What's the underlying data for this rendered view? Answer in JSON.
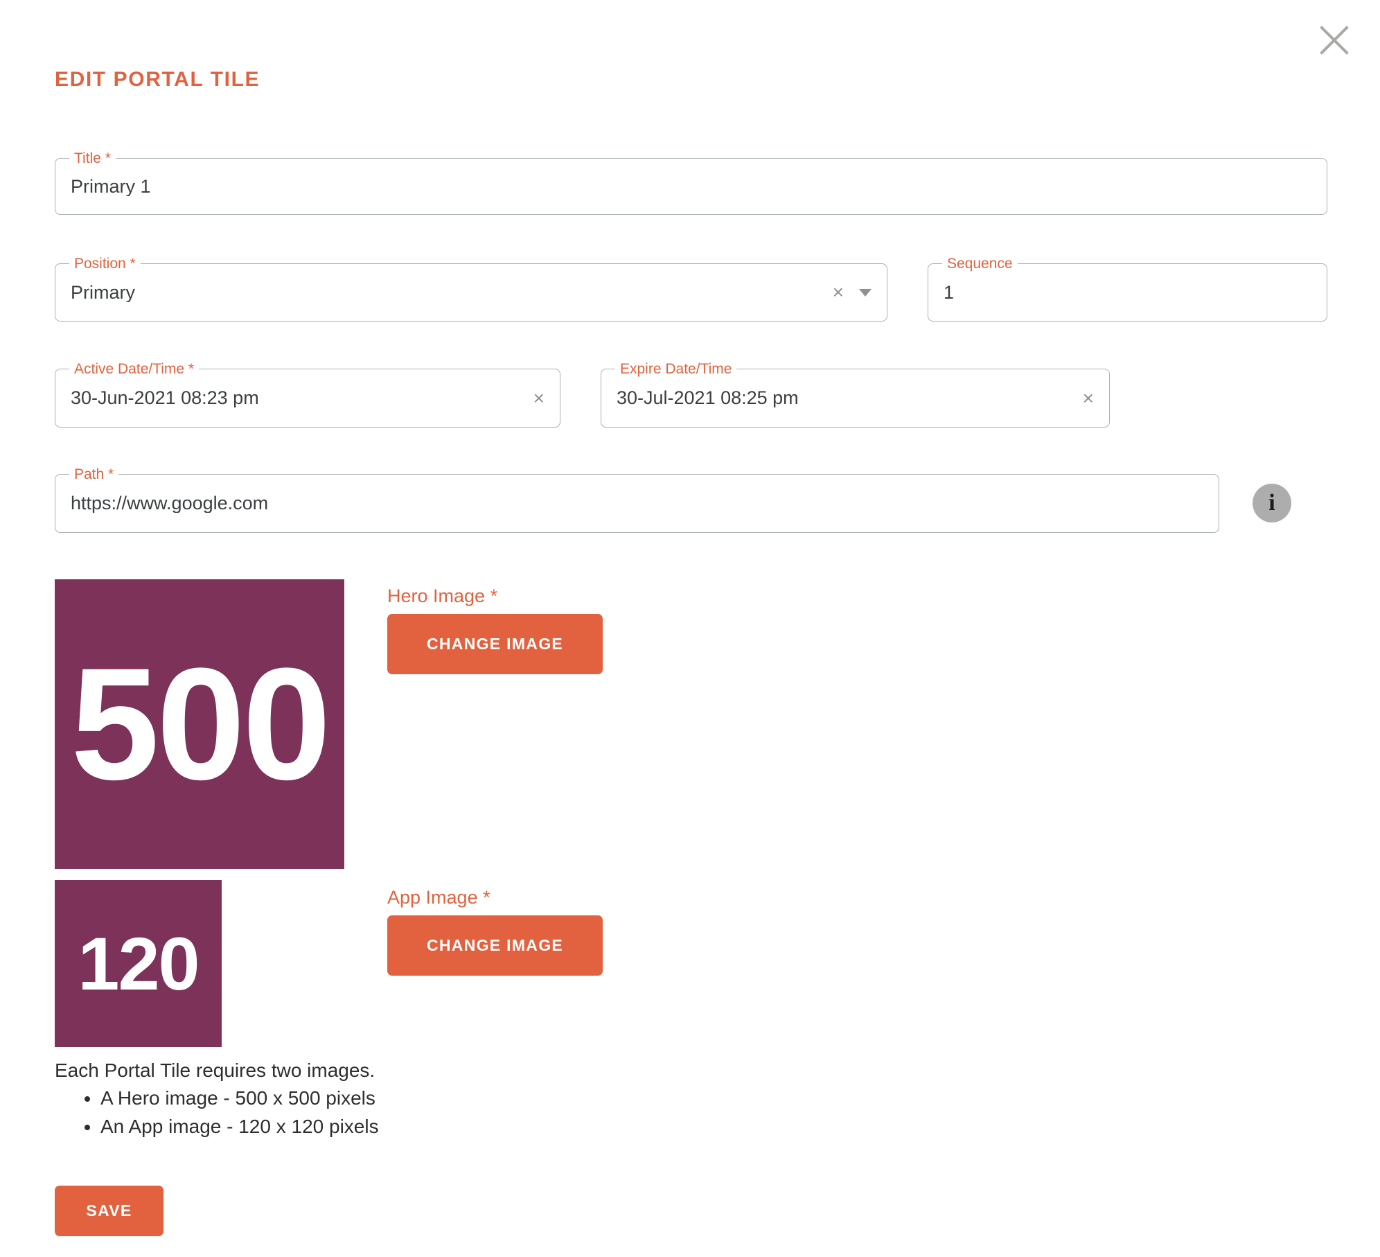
{
  "dialog": {
    "title": "EDIT PORTAL TILE",
    "close_label": "close-icon"
  },
  "accent_colors": {
    "brand_orange": "#E2623F",
    "tile_maroon": "#7D3259",
    "field_border": "#ABB0B0",
    "info_badge_grey": "#ADADAD"
  },
  "fields": {
    "title": {
      "label": "Title *",
      "value": "Primary 1"
    },
    "position": {
      "label": "Position *",
      "value": "Primary",
      "clear_glyph": "×",
      "caret": "chevron-down-icon"
    },
    "sequence": {
      "label": "Sequence",
      "value": "1"
    },
    "active_datetime": {
      "label": "Active Date/Time *",
      "value": "30-Jun-2021 08:23 pm",
      "clear_glyph": "×"
    },
    "expire_datetime": {
      "label": "Expire Date/Time",
      "value": "30-Jul-2021 08:25 pm",
      "clear_glyph": "×"
    },
    "path": {
      "label": "Path *",
      "value": "https://www.google.com",
      "info_glyph": "i"
    }
  },
  "images": {
    "hero": {
      "label": "Hero Image *",
      "tile_text": "500",
      "button_label": "Change Image"
    },
    "app": {
      "label": "App Image *",
      "tile_text": "120",
      "button_label": "Change Image"
    }
  },
  "help": {
    "intro": "Each Portal Tile requires two images.",
    "bullets": [
      "A Hero image - 500 x 500 pixels",
      "An App image - 120 x 120 pixels"
    ]
  },
  "actions": {
    "save_label": "Save"
  }
}
